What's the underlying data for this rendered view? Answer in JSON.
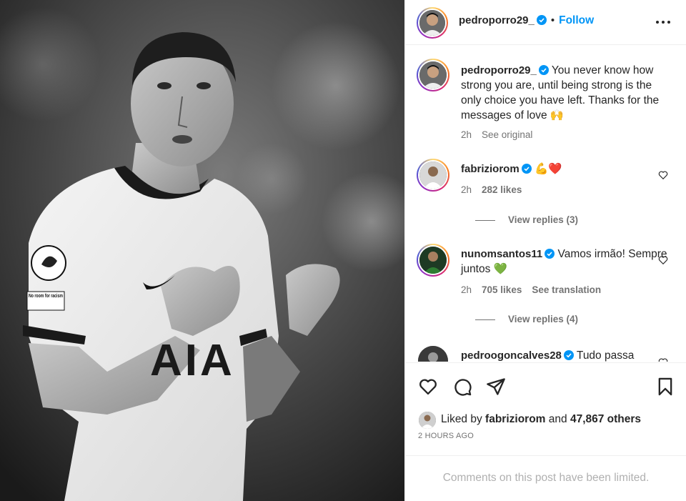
{
  "post": {
    "photo": {
      "jersey_sponsor": "AIA",
      "sleeve_badge": "No room for racism"
    },
    "header": {
      "username": "pedroporro29_",
      "separator": "•",
      "follow_label": "Follow",
      "more_icon": "more-horizontal-icon"
    },
    "caption": {
      "username": "pedroporro29_",
      "text": "You never know how strong you are, until being strong is the only choice you have left. Thanks for the messages of love 🙌",
      "time": "2h",
      "see_original": "See original"
    },
    "comments": [
      {
        "username": "fabriziorom",
        "text": "💪❤️",
        "time": "2h",
        "likes": "282 likes",
        "view_replies": "View replies (3)"
      },
      {
        "username": "nunomsantos11",
        "text": "Vamos irmão! Sempre juntos 💚",
        "time": "2h",
        "likes": "705 likes",
        "see_translation": "See translation",
        "view_replies": "View replies (4)"
      },
      {
        "username": "pedroogoncalves28",
        "text": "Tudo passa"
      }
    ],
    "actions": {
      "like_icon": "heart-icon",
      "comment_icon": "comment-icon",
      "share_icon": "paper-plane-icon",
      "save_icon": "bookmark-icon"
    },
    "liked_by": {
      "prefix": "Liked by",
      "user": "fabriziorom",
      "middle": "and",
      "count": "47,867 others"
    },
    "time_ago": "2 HOURS AGO",
    "comments_limited": "Comments on this post have been limited."
  },
  "colors": {
    "accent": "#0095f6",
    "verified": "#0095f6",
    "text": "#262626",
    "muted": "#737373",
    "border": "#efefef"
  }
}
